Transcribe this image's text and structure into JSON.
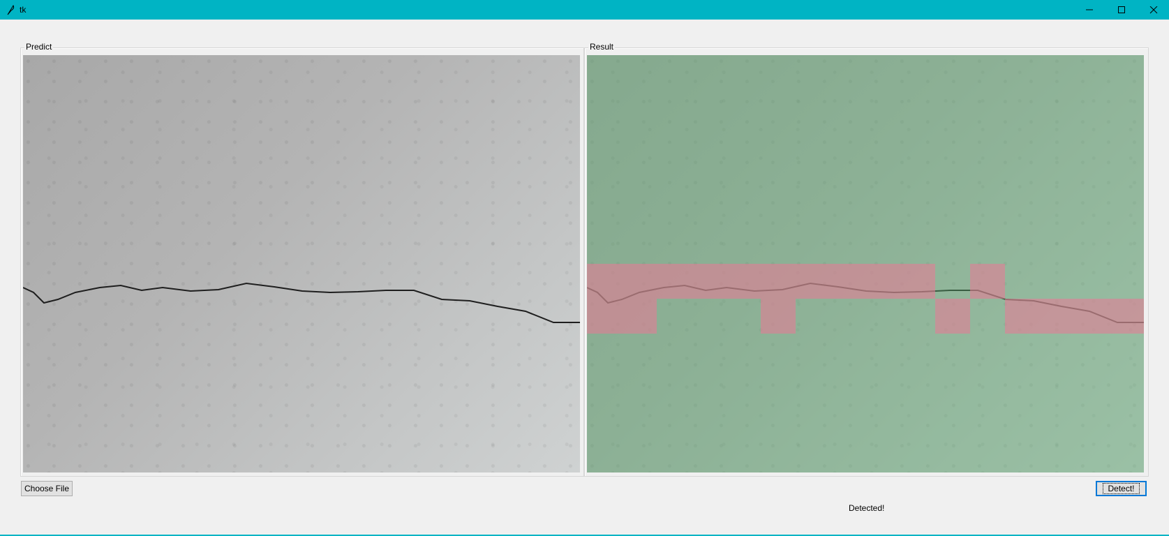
{
  "window": {
    "title": "tk"
  },
  "predict": {
    "label": "Predict"
  },
  "result": {
    "label": "Result",
    "grid": {
      "rows": 12,
      "cols": 16
    },
    "detected_cells": [
      {
        "row": 6,
        "col": 0
      },
      {
        "row": 6,
        "col": 1
      },
      {
        "row": 6,
        "col": 2
      },
      {
        "row": 6,
        "col": 3
      },
      {
        "row": 6,
        "col": 4
      },
      {
        "row": 6,
        "col": 5
      },
      {
        "row": 6,
        "col": 6
      },
      {
        "row": 6,
        "col": 7
      },
      {
        "row": 6,
        "col": 8
      },
      {
        "row": 6,
        "col": 9
      },
      {
        "row": 6,
        "col": 11
      },
      {
        "row": 7,
        "col": 0
      },
      {
        "row": 7,
        "col": 1
      },
      {
        "row": 7,
        "col": 5
      },
      {
        "row": 7,
        "col": 10
      },
      {
        "row": 7,
        "col": 12
      },
      {
        "row": 7,
        "col": 13
      },
      {
        "row": 7,
        "col": 14
      },
      {
        "row": 7,
        "col": 15
      }
    ]
  },
  "buttons": {
    "choose_file": "Choose File",
    "detect": "Detect!"
  },
  "status": {
    "text": "Detected!"
  },
  "colors": {
    "titlebar": "#00b4c4",
    "overlay_ok": "#5aaa6e",
    "overlay_crack": "#eb7896"
  }
}
